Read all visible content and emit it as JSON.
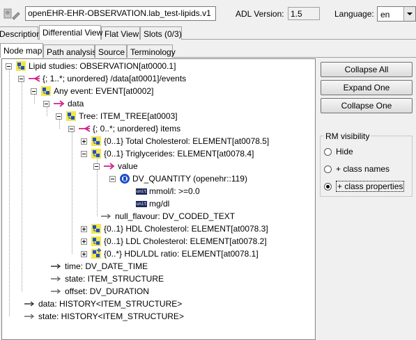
{
  "header": {
    "archetype_id": "openEHR-EHR-OBSERVATION.lab_test-lipids.v1",
    "adl_version_label": "ADL Version:",
    "adl_version_value": "1.5",
    "language_label": "Language:",
    "language_value": "en"
  },
  "main_tabs": [
    {
      "label": "Description",
      "active": false
    },
    {
      "label": "Differential View",
      "active": true
    },
    {
      "label": "Flat View",
      "active": false
    },
    {
      "label": "Slots (0/3)",
      "active": false
    }
  ],
  "sub_tabs": [
    {
      "label": "Node map",
      "active": true
    },
    {
      "label": "Path analysis",
      "active": false
    },
    {
      "label": "Source",
      "active": false
    },
    {
      "label": "Terminology",
      "active": false
    }
  ],
  "tree": {
    "items": [
      {
        "label": "Lipid studies: OBSERVATION[at0000.1]",
        "icon": "object-icon"
      },
      {
        "label": "{; 1..*; unordered} /data[at0001]/events",
        "icon": "multiple-attribute-icon"
      },
      {
        "label": "Any event: EVENT[at0002]",
        "icon": "object-icon"
      },
      {
        "label": "data",
        "icon": "single-attribute-icon"
      },
      {
        "label": "Tree: ITEM_TREE[at0003]",
        "icon": "object-icon"
      },
      {
        "label": "{; 0..*; unordered} items",
        "icon": "multiple-attribute-icon"
      },
      {
        "label": "{0..1} Total Cholesterol: ELEMENT[at0078.5]",
        "icon": "object-icon"
      },
      {
        "label": "{0..1} Triglycerides: ELEMENT[at0078.4]",
        "icon": "object-icon"
      },
      {
        "label": "value",
        "icon": "single-attribute-icon"
      },
      {
        "label": "DV_QUANTITY (openehr::119)",
        "icon": "quantity-icon"
      },
      {
        "label": "mmol/l: >=0.0",
        "icon": "unit-icon"
      },
      {
        "label": "mg/dl",
        "icon": "unit-icon"
      },
      {
        "label": "null_flavour: DV_CODED_TEXT",
        "icon": "rm-attribute-icon"
      },
      {
        "label": "{0..1} HDL Cholesterol: ELEMENT[at0078.3]",
        "icon": "object-icon"
      },
      {
        "label": "{0..1} LDL Cholesterol: ELEMENT[at0078.2]",
        "icon": "object-icon"
      },
      {
        "label": "{0..*} HDL/LDL ratio: ELEMENT[at0078.1]",
        "icon": "object-added-icon"
      },
      {
        "label": "time: DV_DATE_TIME",
        "icon": "rm-attribute-icon"
      },
      {
        "label": "state: ITEM_STRUCTURE",
        "icon": "rm-attribute-icon"
      },
      {
        "label": "offset: DV_DURATION",
        "icon": "rm-attribute-icon"
      },
      {
        "label": "data: HISTORY<ITEM_STRUCTURE>",
        "icon": "rm-attribute-icon"
      },
      {
        "label": "state: HISTORY<ITEM_STRUCTURE>",
        "icon": "rm-attribute-icon"
      }
    ],
    "unit_badge": "unit"
  },
  "actions": {
    "collapse_all": "Collapse All",
    "expand_one": "Expand One",
    "collapse_one": "Collapse One"
  },
  "rm_visibility": {
    "title": "RM visibility",
    "options": [
      {
        "label": "Hide",
        "selected": false
      },
      {
        "label": "+ class names",
        "selected": false
      },
      {
        "label": "+ class properties",
        "selected": true
      }
    ]
  },
  "colors": {
    "object_icon_blue": "#1e50c8",
    "object_icon_yellow": "#f2e64a",
    "attribute_magenta": "#d0208a",
    "unit_badge_navy": "#1c2a5c"
  }
}
